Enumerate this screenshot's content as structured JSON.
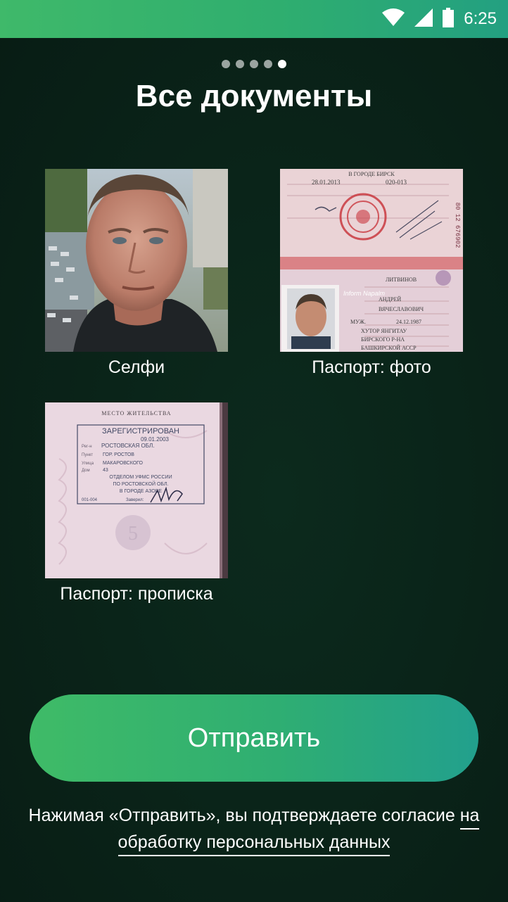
{
  "status_bar": {
    "time": "6:25",
    "icons": [
      "wifi-icon",
      "signal-icon",
      "battery-icon"
    ]
  },
  "pager": {
    "total": 5,
    "current": 5
  },
  "title": "Все документы",
  "documents": [
    {
      "label": "Селфи",
      "thumbnail": "selfie-photo"
    },
    {
      "label": "Паспорт: фото",
      "thumbnail": "passport-photo-page"
    },
    {
      "label": "Паспорт: прописка",
      "thumbnail": "passport-registration-page"
    }
  ],
  "thumbnail_text": {
    "passport_photo": {
      "city": "В ГОРОДЕ БИРСК",
      "issue_date": "28.01.2013",
      "code": "020-013",
      "surname": "ЛИТВИНОВ",
      "name": "АНДРЕЙ",
      "patronymic": "ВЯЧЕСЛАВОВИЧ",
      "sex": "МУЖ.",
      "birth_date": "24.12.1987",
      "birth_place_1": "ХУТОР ЯНГИТАУ",
      "birth_place_2": "БИРСКОГО Р-НА",
      "birth_place_3": "БАШКИРСКОЙ АССР",
      "serial": "80 12 676902",
      "watermark": "Inform Napalm"
    },
    "registration": {
      "header": "МЕСТО ЖИТЕЛЬСТВА",
      "stamp_title": "ЗАРЕГИСТРИРОВАН",
      "date": "09.01.2003",
      "region_label": "Рег-н",
      "region": "РОСТОВСКАЯ ОБЛ.",
      "city_label": "Пункт",
      "city": "ГОР. РОСТОВ",
      "street_label": "Улица",
      "street": "МАКАРОВСКОГО",
      "house_label": "Дом",
      "house": "43",
      "office_1": "ОТДЕЛОМ УФМС РОССИИ",
      "office_2": "ПО РОСТОВСКОЙ ОБЛ.",
      "office_3": "В ГОРОДЕ АЗОВЕ",
      "code": "001-004",
      "certified": "Заверил:"
    }
  },
  "submit_button": {
    "label": "Отправить"
  },
  "consent": {
    "text_before": "Нажимая «Отправить», вы подтверждаете согласие ",
    "link_text": "на обработку персональных данных"
  },
  "colors": {
    "accent_green": "#3fbb67",
    "accent_teal": "#22a08d",
    "background": "#0a2419"
  }
}
